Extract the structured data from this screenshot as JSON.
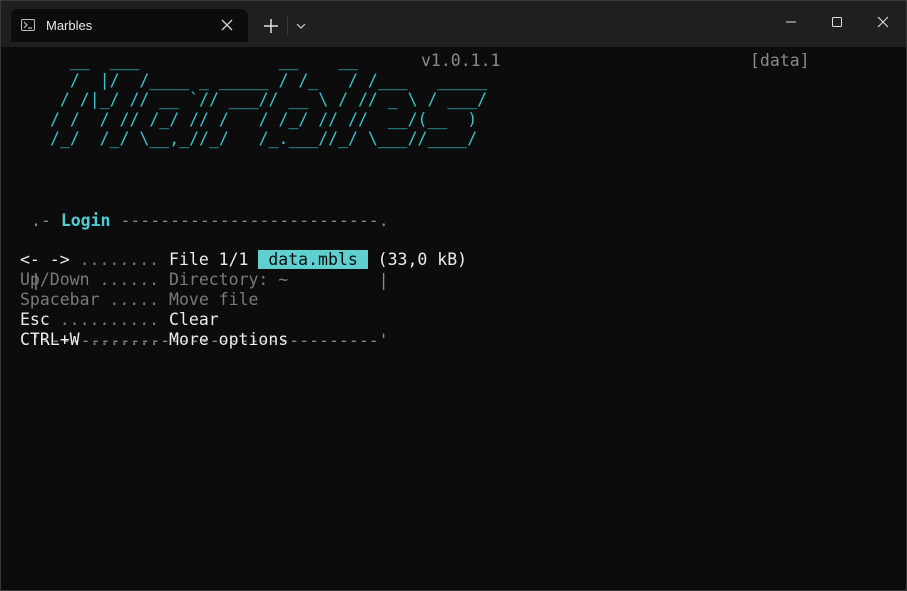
{
  "tab": {
    "title": "Marbles"
  },
  "header": {
    "version": "v1.0.1.1",
    "dataset": "[data]",
    "logo_lines": [
      "  __  ___              __    __               ",
      "  /  |/  /____ _ _____ / /_   / /___   _____",
      " / /|_/ // __ `// ___// __ \\ / // _ \\ / ___/",
      "/ /  / // /_/ // /   / /_/ // //  __/(__  ) ",
      "/_/  /_/ \\__,_//_/   /_.___//_/ \\___//____/  "
    ]
  },
  "login": {
    "title": "Login",
    "top_left": ".- ",
    "top_right": " --------------------------.",
    "middle": "|                                  |",
    "bottom": "'----------------------------------'"
  },
  "keys": [
    {
      "key": "<- ->",
      "dots": " ........ ",
      "action": "File 1/1"
    },
    {
      "key": "Up/Down",
      "dots": " ...... ",
      "action": "Directory: ~"
    },
    {
      "key": "Spacebar",
      "dots": " ..... ",
      "action": "Move file"
    },
    {
      "key": "Esc",
      "dots": " .......... ",
      "action": "Clear"
    },
    {
      "key": "CTRL+W",
      "dots": " ....... ",
      "action": "More options"
    }
  ],
  "file": {
    "name": " data.mbls ",
    "size": " (33,0 kB)"
  }
}
